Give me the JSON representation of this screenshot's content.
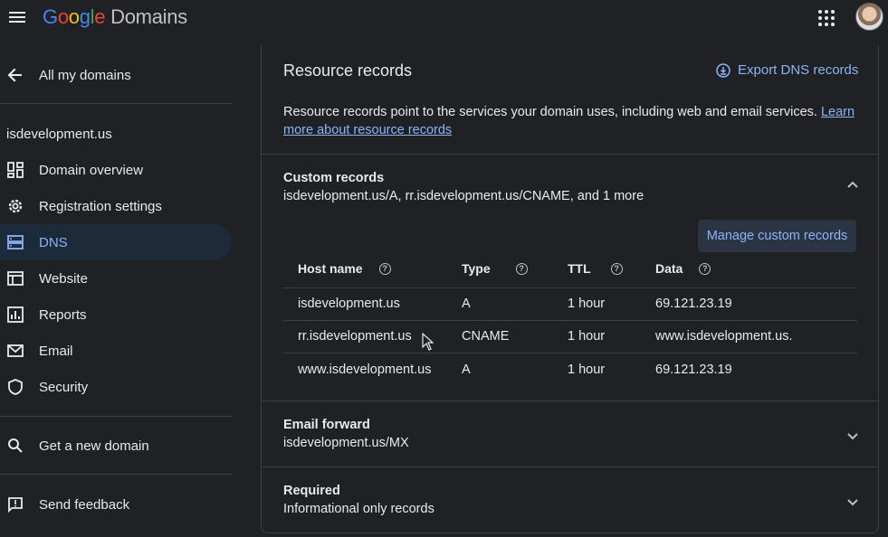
{
  "header": {
    "logo_google": [
      "G",
      "o",
      "o",
      "g",
      "l",
      "e"
    ],
    "logo_product": "Domains"
  },
  "sidebar": {
    "back_label": "All my domains",
    "domain": "isdevelopment.us",
    "items": [
      {
        "label": "Domain overview"
      },
      {
        "label": "Registration settings"
      },
      {
        "label": "DNS"
      },
      {
        "label": "Website"
      },
      {
        "label": "Reports"
      },
      {
        "label": "Email"
      },
      {
        "label": "Security"
      }
    ],
    "get_domain": "Get a new domain",
    "feedback": "Send feedback"
  },
  "main": {
    "title": "Resource records",
    "export_label": "Export DNS records",
    "description": "Resource records point to the services your domain uses, including web and email services. ",
    "learn_more": "Learn more about resource records",
    "custom": {
      "title": "Custom records",
      "summary": "isdevelopment.us/A, rr.isdevelopment.us/CNAME, and 1 more",
      "manage_label": "Manage custom records",
      "columns": [
        "Host name",
        "Type",
        "TTL",
        "Data"
      ],
      "rows": [
        [
          "isdevelopment.us",
          "A",
          "1 hour",
          "69.121.23.19"
        ],
        [
          "rr.isdevelopment.us",
          "CNAME",
          "1 hour",
          "www.isdevelopment.us."
        ],
        [
          "www.isdevelopment.us",
          "A",
          "1 hour",
          "69.121.23.19"
        ]
      ]
    },
    "email_forward": {
      "title": "Email forward",
      "summary": "isdevelopment.us/MX"
    },
    "required": {
      "title": "Required",
      "summary": "Informational only records"
    }
  },
  "colors": {
    "background": "#202124",
    "accent": "#8ab4f8",
    "divider": "#3c4043"
  }
}
